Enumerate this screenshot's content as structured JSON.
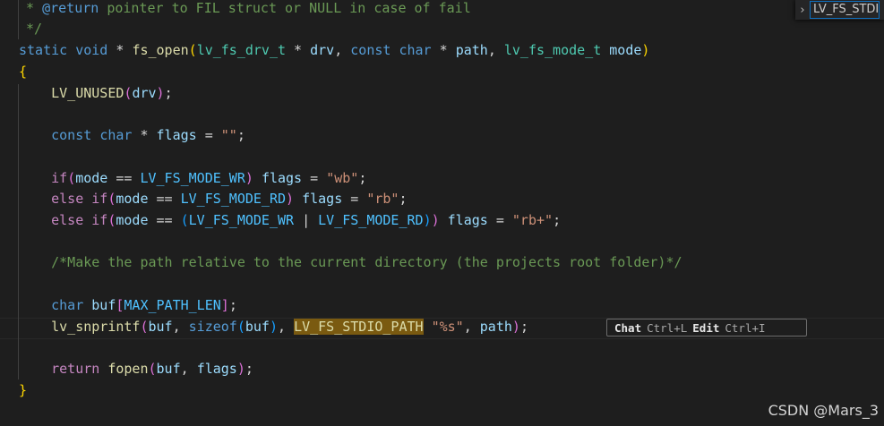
{
  "breadcrumb": {
    "symbol": "LV_FS_STDIO_PATH"
  },
  "inline_hint": {
    "chat_label": "Chat",
    "chat_shortcut": "Ctrl+L",
    "edit_label": "Edit",
    "edit_shortcut": "Ctrl+I"
  },
  "watermark": "CSDN @Mars_3",
  "code": {
    "l1": {
      "a": " * ",
      "b": "@return",
      "c": " pointer to FIL struct or NULL in case of fail"
    },
    "l2": " */",
    "l3": {
      "a": "static",
      "b": " ",
      "c": "void",
      "d": " * ",
      "e": "fs_open",
      "f": "(",
      "g": "lv_fs_drv_t",
      "h": " * ",
      "i": "drv",
      "j": ", ",
      "k": "const",
      "l": " ",
      "m": "char",
      "n": " * ",
      "o": "path",
      "p": ", ",
      "q": "lv_fs_mode_t",
      "r": " ",
      "s": "mode",
      "t": ")"
    },
    "l4": "{",
    "l5": {
      "a": "    ",
      "b": "LV_UNUSED",
      "c": "(",
      "d": "drv",
      "e": ")",
      "f": ";"
    },
    "l6": {
      "a": "    ",
      "b": "const",
      "c": " ",
      "d": "char",
      "e": " * ",
      "f": "flags",
      "g": " = ",
      "h": "\"\"",
      "i": ";"
    },
    "l7": {
      "a": "    ",
      "b": "if",
      "c": "(",
      "d": "mode",
      "e": " == ",
      "f": "LV_FS_MODE_WR",
      "g": ")",
      "h": " ",
      "i": "flags",
      "j": " = ",
      "k": "\"wb\"",
      "l": ";"
    },
    "l8": {
      "a": "    ",
      "b": "else",
      "c": " ",
      "d": "if",
      "e": "(",
      "f": "mode",
      "g": " == ",
      "h": "LV_FS_MODE_RD",
      "i": ")",
      "j": " ",
      "k": "flags",
      "l": " = ",
      "m": "\"rb\"",
      "n": ";"
    },
    "l9": {
      "a": "    ",
      "b": "else",
      "c": " ",
      "d": "if",
      "e": "(",
      "f": "mode",
      "g": " == ",
      "h": "(",
      "i": "LV_FS_MODE_WR",
      "j": " | ",
      "k": "LV_FS_MODE_RD",
      "l": ")",
      "m": ")",
      "n": " ",
      "o": "flags",
      "p": " = ",
      "q": "\"rb+\"",
      "r": ";"
    },
    "l10": {
      "a": "    ",
      "b": "/*Make the path relative to the current directory (the projects root folder)*/"
    },
    "l11": {
      "a": "    ",
      "b": "char",
      "c": " ",
      "d": "buf",
      "e": "[",
      "f": "MAX_PATH_LEN",
      "g": "]",
      "h": ";"
    },
    "l12": {
      "a": "    ",
      "b": "lv_snprintf",
      "c": "(",
      "d": "buf",
      "e": ", ",
      "f": "sizeof",
      "g": "(",
      "h": "buf",
      "i": ")",
      "j": ", ",
      "k": "LV_FS_STDIO_PATH",
      "l": " ",
      "m": "\"%s\"",
      "n": ", ",
      "o": "path",
      "p": ")",
      "q": ";"
    },
    "l13": {
      "a": "    ",
      "b": "return",
      "c": " ",
      "d": "fopen",
      "e": "(",
      "f": "buf",
      "g": ", ",
      "h": "flags",
      "i": ")",
      "j": ";"
    },
    "l14": "}"
  }
}
